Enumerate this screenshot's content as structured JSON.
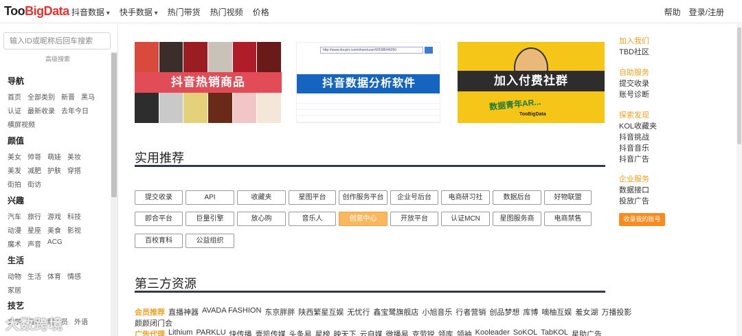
{
  "brand": {
    "logo_a": "Too",
    "logo_b": "BigData"
  },
  "nav": [
    "抖音数据",
    "快手数据",
    "热门带货",
    "热门视频",
    "价格"
  ],
  "top_right": {
    "help": "帮助",
    "login": "登录/注册"
  },
  "sidebar": {
    "search_placeholder": "输入ID或昵称后回车搜索",
    "advanced": "高级搜索",
    "sections": [
      {
        "title": "导航",
        "rows": [
          [
            "首页",
            "全部类别",
            "新晋",
            "黑马"
          ],
          [
            "认证",
            "最新收录",
            "去年今日"
          ],
          [
            "横屏视频"
          ]
        ]
      },
      {
        "title": "颜值",
        "rows": [
          [
            "美女",
            "帅哥",
            "萌娃",
            "美妆"
          ],
          [
            "美发",
            "减肥",
            "护肤",
            "穿搭"
          ],
          [
            "街拍",
            "街访"
          ]
        ]
      },
      {
        "title": "兴趣",
        "rows": [
          [
            "汽车",
            "旅行",
            "游戏",
            "科技"
          ],
          [
            "动漫",
            "星座",
            "美食",
            "影视"
          ],
          [
            "魔术",
            "声音",
            "ACG"
          ]
        ]
      },
      {
        "title": "生活",
        "rows": [
          [
            "动物",
            "生活",
            "体育",
            "情感"
          ],
          [
            "家居"
          ]
        ]
      },
      {
        "title": "技艺",
        "rows": [
          [
            "文学",
            "画画",
            "程序员",
            "外语"
          ]
        ]
      }
    ]
  },
  "banners": {
    "b1": "抖音热销商品",
    "b2": "抖音数据分析软件",
    "b2_url": "http://www.douyin.com/share/user/66598046050",
    "b3": "加入付费社群",
    "b3_slogan": "数据青年AR...",
    "b3_brand": "TooBigData"
  },
  "practical": {
    "title": "实用推荐",
    "rows": [
      [
        "提交收录",
        "API",
        "收藏夹",
        "星图平台",
        "创作服务平台",
        "企业号后台",
        "电商研习社",
        "数据后台",
        "好物联盟"
      ],
      [
        "即合平台",
        "巨量引擎",
        "放心购",
        "音乐人",
        "创意中心",
        "开放平台",
        "认证MCN",
        "星图服务商",
        "电商禁售"
      ],
      [
        "百校育科",
        "公益组织"
      ]
    ]
  },
  "third_party": {
    "title": "第三方资源",
    "member_lead": "会员推荐",
    "members": [
      "直播神器",
      "AVADA FASHION",
      "东京胖胖",
      "陕西繁星互娱",
      "无忧行",
      "鑫宝鹭旗舰店",
      "小旭音乐",
      "行者营销",
      "创品梦想",
      "库博",
      "嘀柚互娱",
      "羞女湖",
      "万播投影"
    ],
    "members_2": [
      "颜颜闭门会"
    ],
    "ad_lead": "广告代理",
    "ads": [
      "Lithium",
      "PARKLU",
      "快传播",
      "壹凯传媒",
      "头条易",
      "星榜",
      "映天下",
      "云自媒",
      "微播易",
      "克劳锐",
      "领库",
      "领袖",
      "Kooleader",
      "SoKOL",
      "TabKOL",
      "星助广告"
    ]
  },
  "right": {
    "groups": [
      {
        "head": "加入我们",
        "items": [
          "TBD社区"
        ]
      },
      {
        "head": "自助服务",
        "items": [
          "提交收录",
          "账号诊断"
        ]
      },
      {
        "head": "探索发现",
        "items": [
          "KOL收藏夹",
          "抖音挑战",
          "抖音音乐",
          "抖音广告"
        ]
      },
      {
        "head": "企业服务",
        "items": [
          "数据接口",
          "投放广告"
        ]
      }
    ],
    "promo": "收录我的账号"
  },
  "watermark": "大数跨境",
  "colors": {
    "accent": "#f0a020",
    "red_bar": "#e24c56",
    "blue_bar": "#1565c0",
    "yellow": "#f5c518",
    "heading_line": "#333a45"
  }
}
